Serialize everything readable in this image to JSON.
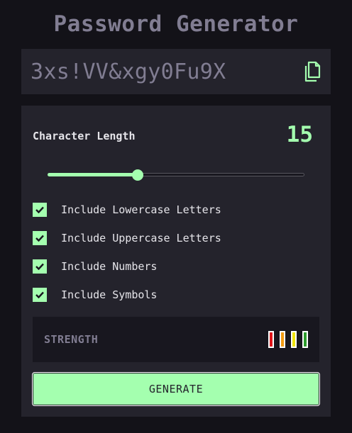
{
  "app": {
    "title": "Password Generator"
  },
  "password": {
    "value": "3xs!VV&xgy0Fu9X",
    "copy_icon": "copy-icon"
  },
  "length": {
    "label": "Character Length",
    "value": "15",
    "slider_fraction": 0.35
  },
  "options": [
    {
      "label": "Include Lowercase Letters",
      "checked": true
    },
    {
      "label": "Include Uppercase Letters",
      "checked": true
    },
    {
      "label": "Include Numbers",
      "checked": true
    },
    {
      "label": "Include Symbols",
      "checked": true
    }
  ],
  "strength": {
    "label": "STRENGTH",
    "bars": [
      {
        "color": "#e0161b"
      },
      {
        "color": "#f39c12"
      },
      {
        "color": "#f1e40b"
      },
      {
        "color": "#2e9c2e"
      }
    ]
  },
  "generate": {
    "label": "GENERATE"
  },
  "colors": {
    "accent": "#a4ffaf",
    "background": "#131218",
    "panel": "#24232c",
    "muted": "#817d92"
  }
}
